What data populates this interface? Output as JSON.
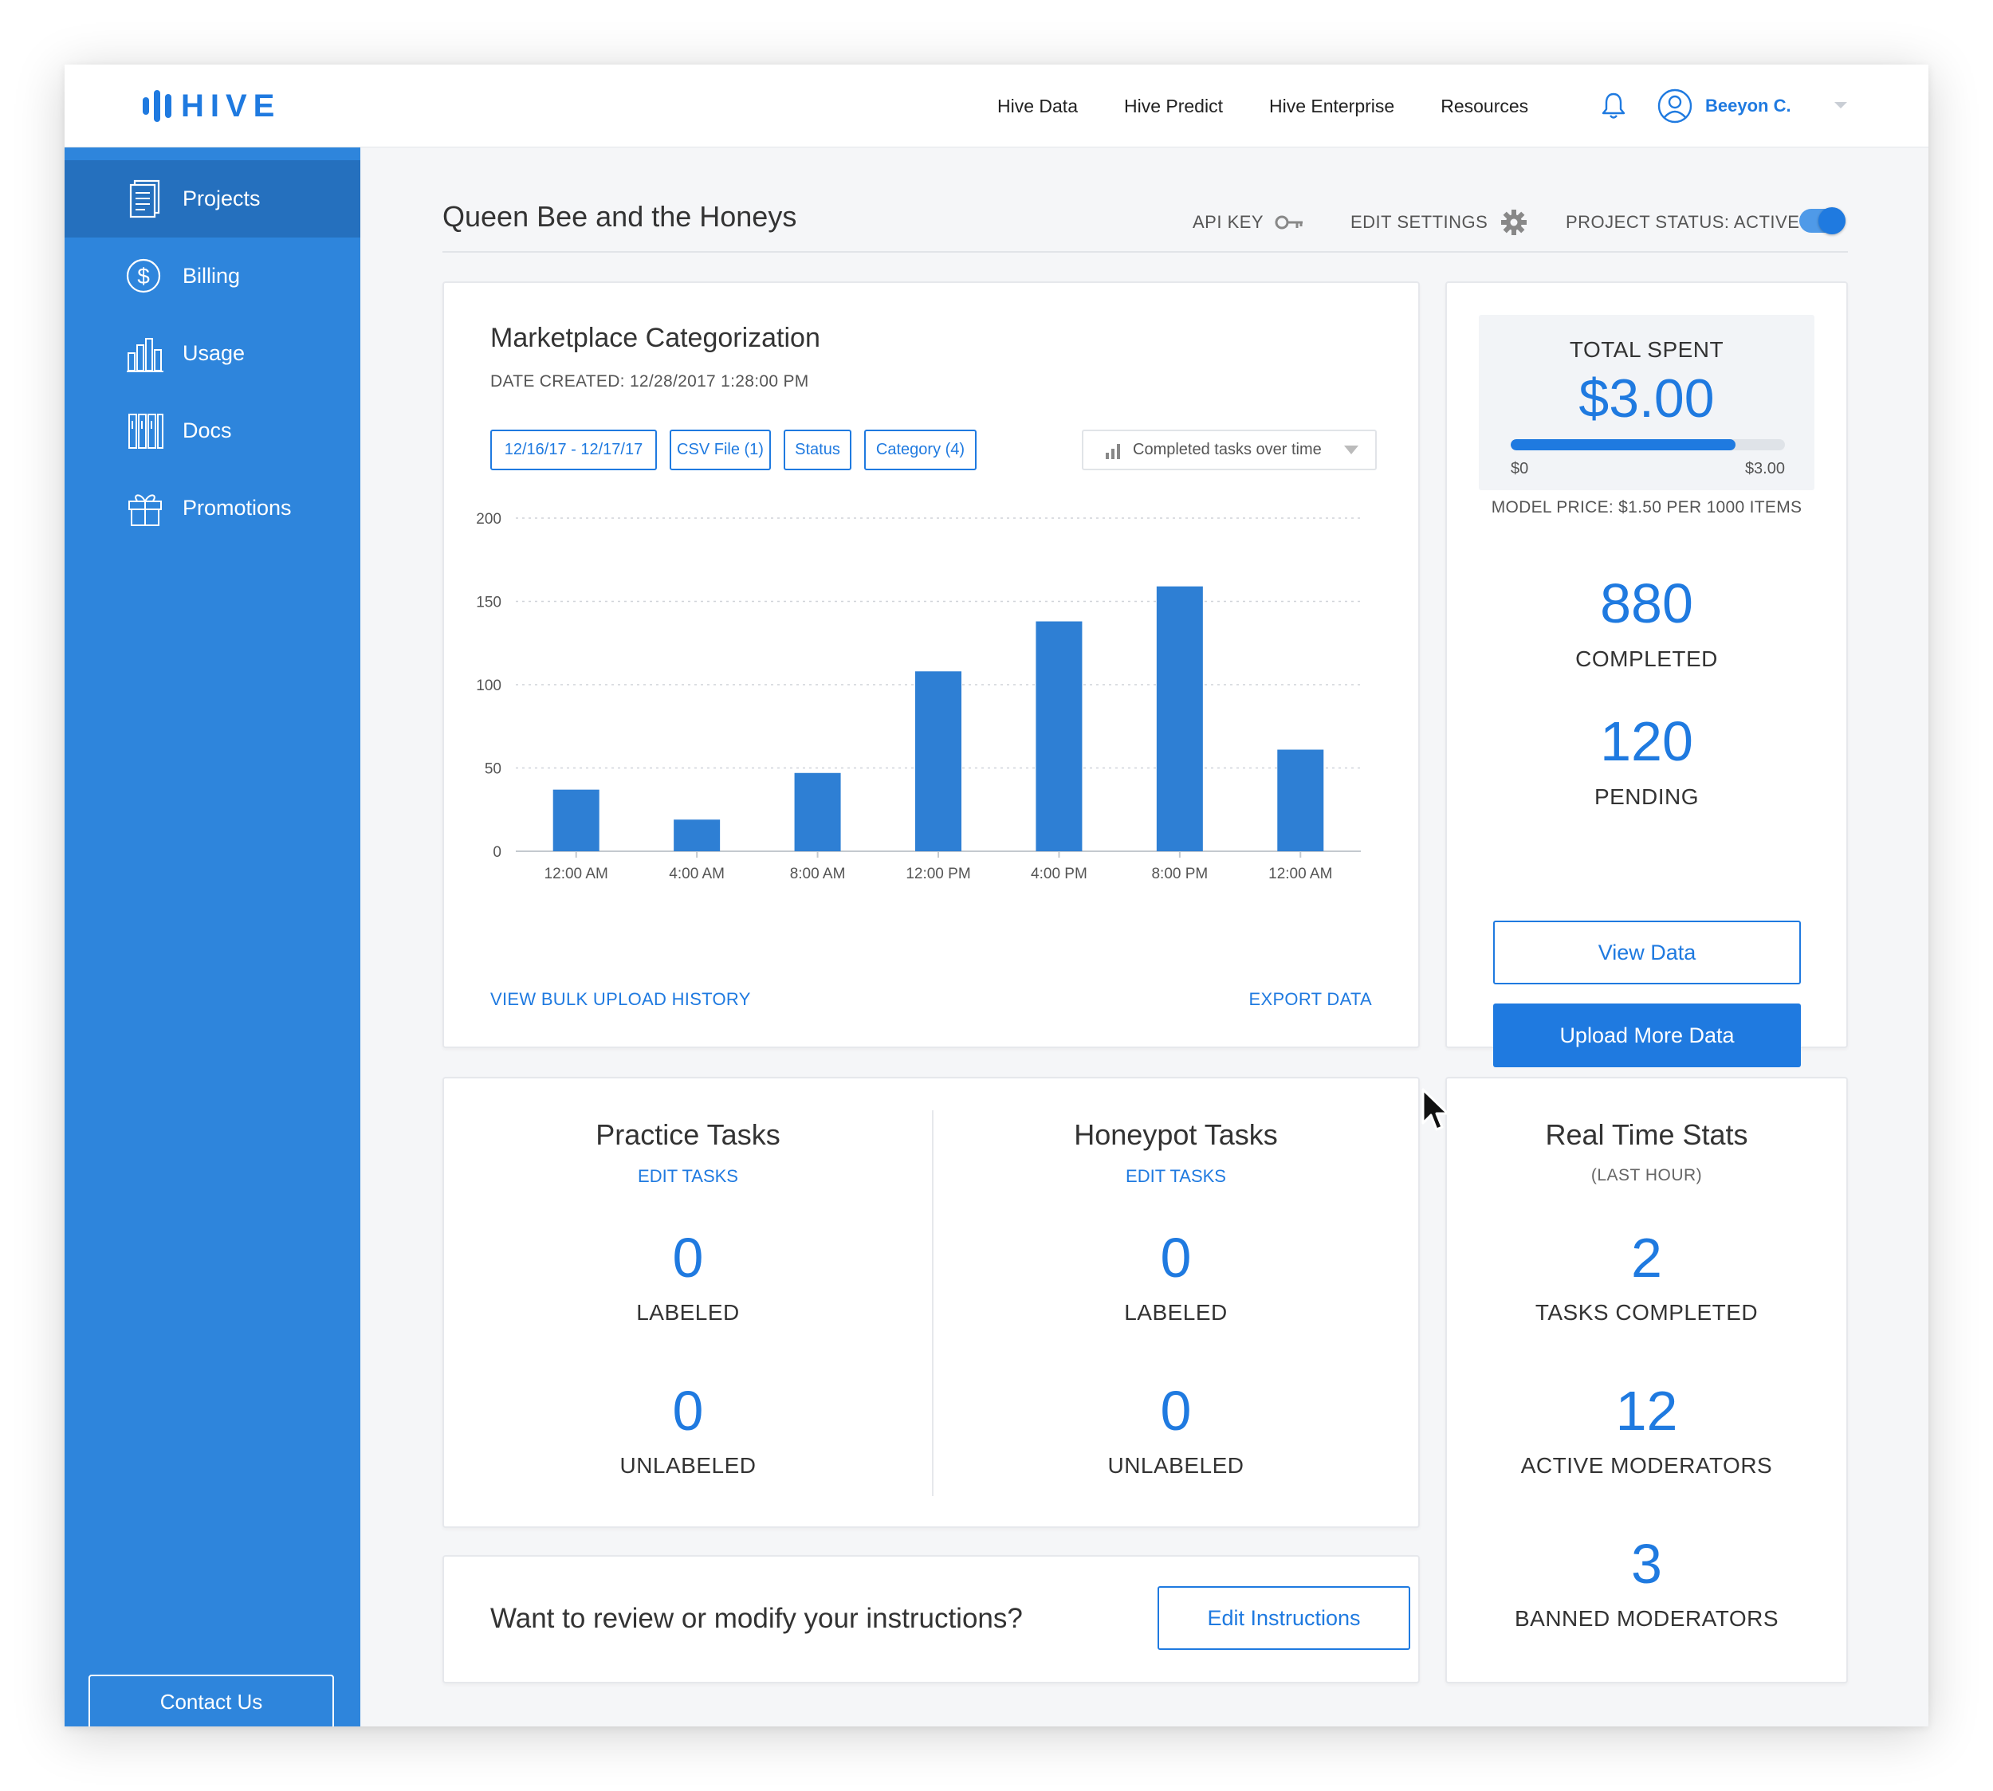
{
  "brand": {
    "logo_text": "HIVE",
    "accent": "#1f7ae0",
    "sidebar_bg": "#2e85dc"
  },
  "topnav": {
    "links": [
      "Hive Data",
      "Hive Predict",
      "Hive Enterprise",
      "Resources"
    ],
    "user_name": "Beeyon C."
  },
  "sidebar": {
    "items": [
      {
        "label": "Projects",
        "icon": "document-icon",
        "active": true
      },
      {
        "label": "Billing",
        "icon": "dollar-icon"
      },
      {
        "label": "Usage",
        "icon": "bar-chart-icon"
      },
      {
        "label": "Docs",
        "icon": "books-icon"
      },
      {
        "label": "Promotions",
        "icon": "gift-icon"
      }
    ],
    "contact_label": "Contact Us"
  },
  "header": {
    "project_title": "Queen Bee and the Honeys",
    "api_key_label": "API KEY",
    "edit_settings_label": "EDIT SETTINGS",
    "status_label": "PROJECT STATUS: ACTIVE"
  },
  "chart_card": {
    "title": "Marketplace Categorization",
    "date_created": "DATE CREATED: 12/28/2017  1:28:00 PM",
    "filters": [
      "12/16/17 - 12/17/17",
      "CSV File (1)",
      "Status",
      "Category (4)"
    ],
    "dropdown_label": "Completed tasks over time",
    "bulk_link": "VIEW BULK UPLOAD HISTORY",
    "export_link": "EXPORT DATA"
  },
  "chart_data": {
    "type": "bar",
    "categories": [
      "12:00 AM",
      "4:00 AM",
      "8:00 AM",
      "12:00 PM",
      "4:00 PM",
      "8:00 PM",
      "12:00 AM"
    ],
    "values": [
      37,
      19,
      47,
      108,
      138,
      159,
      61
    ],
    "yticks": [
      0,
      50,
      100,
      150,
      200
    ],
    "ylim": [
      0,
      200
    ],
    "grid": true,
    "color": "#2e7fd4"
  },
  "spend": {
    "label": "TOTAL SPENT",
    "value": "$3.00",
    "progress": 0.82,
    "min_label": "$0",
    "max_label": "$3.00",
    "model_price": "MODEL PRICE: $1.50 PER 1000 ITEMS",
    "completed_value": "880",
    "completed_label": "COMPLETED",
    "pending_value": "120",
    "pending_label": "PENDING",
    "view_data": "View Data",
    "upload_more": "Upload More Data"
  },
  "tasks": {
    "practice": {
      "title": "Practice Tasks",
      "edit": "EDIT TASKS",
      "labeled": "0",
      "labeled_label": "LABELED",
      "unlabeled": "0",
      "unlabeled_label": "UNLABELED"
    },
    "honeypot": {
      "title": "Honeypot Tasks",
      "edit": "EDIT TASKS",
      "labeled": "0",
      "labeled_label": "LABELED",
      "unlabeled": "0",
      "unlabeled_label": "UNLABELED"
    }
  },
  "realtime": {
    "title": "Real Time Stats",
    "subtitle": "(LAST HOUR)",
    "stats": [
      {
        "value": "2",
        "label": "TASKS COMPLETED"
      },
      {
        "value": "12",
        "label": "ACTIVE MODERATORS"
      },
      {
        "value": "3",
        "label": "BANNED MODERATORS"
      }
    ]
  },
  "instructions": {
    "prompt": "Want to review or modify your instructions?",
    "button": "Edit Instructions"
  }
}
